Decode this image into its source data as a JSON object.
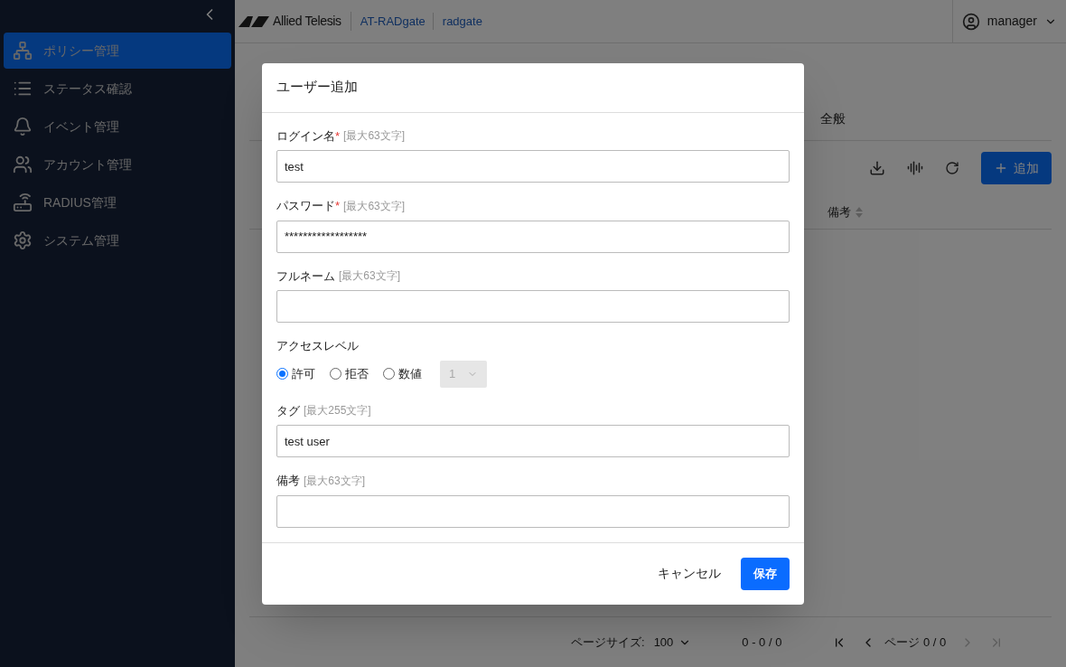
{
  "sidebar": {
    "items": [
      {
        "label": "ポリシー管理",
        "selected": true
      },
      {
        "label": "ステータス確認",
        "selected": false
      },
      {
        "label": "イベント管理",
        "selected": false
      },
      {
        "label": "アカウント管理",
        "selected": false
      },
      {
        "label": "RADIUS管理",
        "selected": false
      },
      {
        "label": "システム管理",
        "selected": false
      }
    ]
  },
  "header": {
    "logo": "Allied Telesis",
    "product": "AT-RADgate",
    "host": "radgate",
    "user": "manager"
  },
  "page": {
    "tabs": [
      {
        "label": "全般",
        "selected": false
      }
    ],
    "add_button": "追加",
    "columns": [
      "備考"
    ],
    "pagination": {
      "page_size_label": "ページサイズ:",
      "page_size": "100",
      "range": "0 - 0 / 0",
      "page": "ページ 0 / 0"
    }
  },
  "dialog": {
    "title": "ユーザー追加",
    "fields": [
      {
        "kind": "text",
        "label": "ログイン名",
        "required_mark": "*",
        "hint": "[最大63文字]",
        "value": "test"
      },
      {
        "kind": "text",
        "label": "パスワード",
        "required_mark": "*",
        "hint": "[最大63文字]",
        "value": "******************"
      },
      {
        "kind": "text",
        "label": "フルネーム",
        "hint": "[最大63文字]"
      },
      {
        "kind": "radio",
        "label": "アクセスレベル",
        "options": [
          {
            "label": "許可",
            "selected": true
          },
          {
            "label": "拒否",
            "selected": false
          },
          {
            "label": "数値",
            "selected": false
          }
        ],
        "number": "1"
      },
      {
        "kind": "text",
        "label": "タグ",
        "hint": "[最大255文字]",
        "value": "test user"
      },
      {
        "kind": "text",
        "label": "備考",
        "hint": "[最大63文字]"
      }
    ],
    "cancel": "キャンセル",
    "save": "保存"
  }
}
